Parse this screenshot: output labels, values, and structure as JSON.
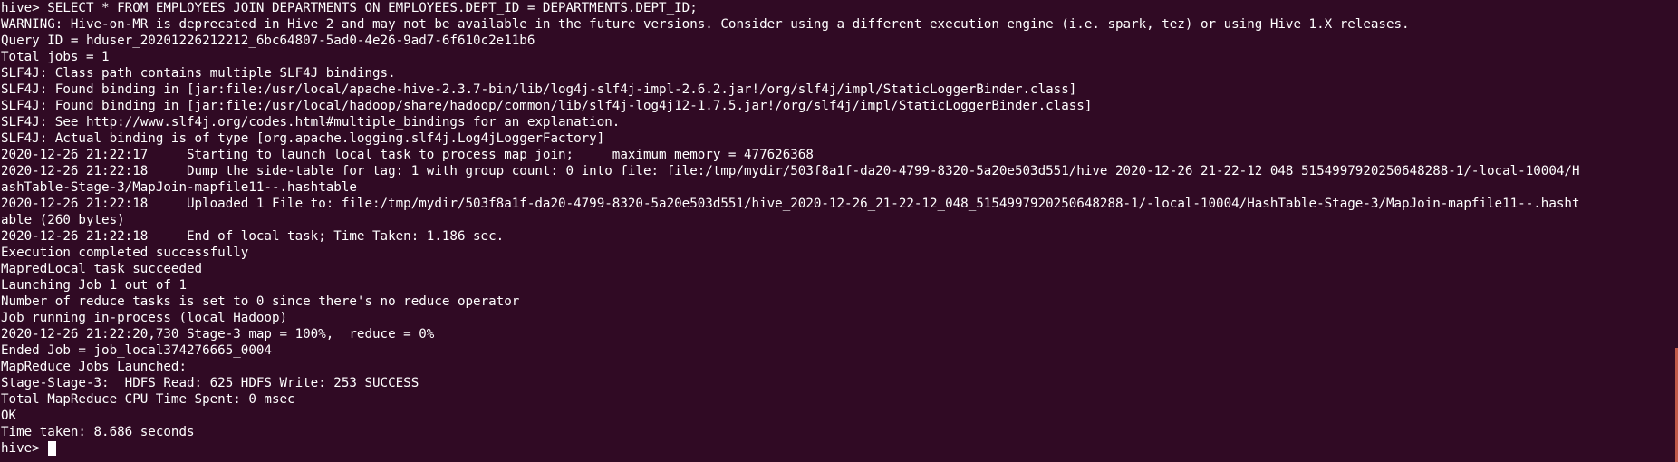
{
  "terminal": {
    "lines": [
      "hive> SELECT * FROM EMPLOYEES JOIN DEPARTMENTS ON EMPLOYEES.DEPT_ID = DEPARTMENTS.DEPT_ID;",
      "WARNING: Hive-on-MR is deprecated in Hive 2 and may not be available in the future versions. Consider using a different execution engine (i.e. spark, tez) or using Hive 1.X releases.",
      "Query ID = hduser_20201226212212_6bc64807-5ad0-4e26-9ad7-6f610c2e11b6",
      "Total jobs = 1",
      "SLF4J: Class path contains multiple SLF4J bindings.",
      "SLF4J: Found binding in [jar:file:/usr/local/apache-hive-2.3.7-bin/lib/log4j-slf4j-impl-2.6.2.jar!/org/slf4j/impl/StaticLoggerBinder.class]",
      "SLF4J: Found binding in [jar:file:/usr/local/hadoop/share/hadoop/common/lib/slf4j-log4j12-1.7.5.jar!/org/slf4j/impl/StaticLoggerBinder.class]",
      "SLF4J: See http://www.slf4j.org/codes.html#multiple_bindings for an explanation.",
      "SLF4J: Actual binding is of type [org.apache.logging.slf4j.Log4jLoggerFactory]",
      "2020-12-26 21:22:17     Starting to launch local task to process map join;     maximum memory = 477626368",
      "2020-12-26 21:22:18     Dump the side-table for tag: 1 with group count: 0 into file: file:/tmp/mydir/503f8a1f-da20-4799-8320-5a20e503d551/hive_2020-12-26_21-22-12_048_5154997920250648288-1/-local-10004/H",
      "ashTable-Stage-3/MapJoin-mapfile11--.hashtable",
      "2020-12-26 21:22:18     Uploaded 1 File to: file:/tmp/mydir/503f8a1f-da20-4799-8320-5a20e503d551/hive_2020-12-26_21-22-12_048_5154997920250648288-1/-local-10004/HashTable-Stage-3/MapJoin-mapfile11--.hasht",
      "able (260 bytes)",
      "2020-12-26 21:22:18     End of local task; Time Taken: 1.186 sec.",
      "Execution completed successfully",
      "MapredLocal task succeeded",
      "Launching Job 1 out of 1",
      "Number of reduce tasks is set to 0 since there's no reduce operator",
      "Job running in-process (local Hadoop)",
      "2020-12-26 21:22:20,730 Stage-3 map = 100%,  reduce = 0%",
      "Ended Job = job_local374276665_0004",
      "MapReduce Jobs Launched:",
      "Stage-Stage-3:  HDFS Read: 625 HDFS Write: 253 SUCCESS",
      "Total MapReduce CPU Time Spent: 0 msec",
      "OK",
      "Time taken: 8.686 seconds"
    ],
    "prompt": "hive> ",
    "colors": {
      "background": "#300a24",
      "foreground": "#ffffff",
      "scrollbar": "#c25a4a"
    }
  }
}
